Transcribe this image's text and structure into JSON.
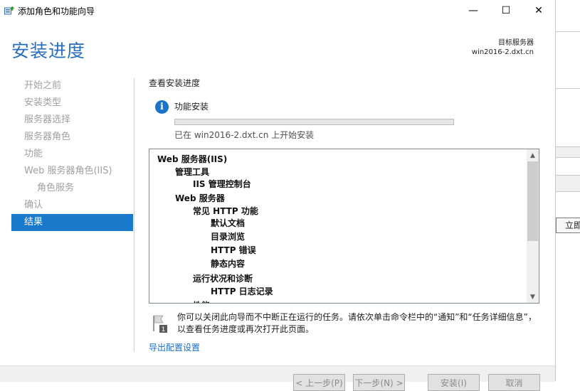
{
  "window": {
    "title": "添加角色和功能向导",
    "minimize": "—",
    "maximize": "☐",
    "close": "✕"
  },
  "header": {
    "page_title": "安装进度",
    "target_label": "目标服务器",
    "target_server": "win2016-2.dxt.cn"
  },
  "nav": {
    "items": [
      {
        "label": "开始之前"
      },
      {
        "label": "安装类型"
      },
      {
        "label": "服务器选择"
      },
      {
        "label": "服务器角色"
      },
      {
        "label": "功能"
      },
      {
        "label": "Web 服务器角色(IIS)"
      },
      {
        "label": "角色服务"
      },
      {
        "label": "确认"
      },
      {
        "label": "结果"
      }
    ]
  },
  "main": {
    "section_title": "查看安装进度",
    "install_label": "功能安装",
    "progress_fraction": 0.0,
    "progress_status": "已在 win2016-2.dxt.cn 上开始安装",
    "features": [
      {
        "label": "Web 服务器(IIS)"
      },
      {
        "label": "管理工具"
      },
      {
        "label": "IIS 管理控制台"
      },
      {
        "label": "Web 服务器"
      },
      {
        "label": "常见 HTTP 功能"
      },
      {
        "label": "默认文档"
      },
      {
        "label": "目录浏览"
      },
      {
        "label": "HTTP 错误"
      },
      {
        "label": "静态内容"
      },
      {
        "label": "运行状况和诊断"
      },
      {
        "label": "HTTP 日志记录"
      },
      {
        "label": "性能"
      }
    ],
    "note": "你可以关闭此向导而不中断正在运行的任务。请依次单击命令栏中的“通知”和“任务详细信息”，以查看任务进度或再次打开此页面。",
    "export_link": "导出配置设置"
  },
  "footer": {
    "prev": "< 上一步(P)",
    "next": "下一步(N) >",
    "install": "安装(I)",
    "cancel": "取消"
  },
  "background": {
    "partial_button": "立即"
  },
  "colors": {
    "accent": "#1979ca",
    "title_blue": "#2a6ebb",
    "link": "#1a6fc3"
  }
}
